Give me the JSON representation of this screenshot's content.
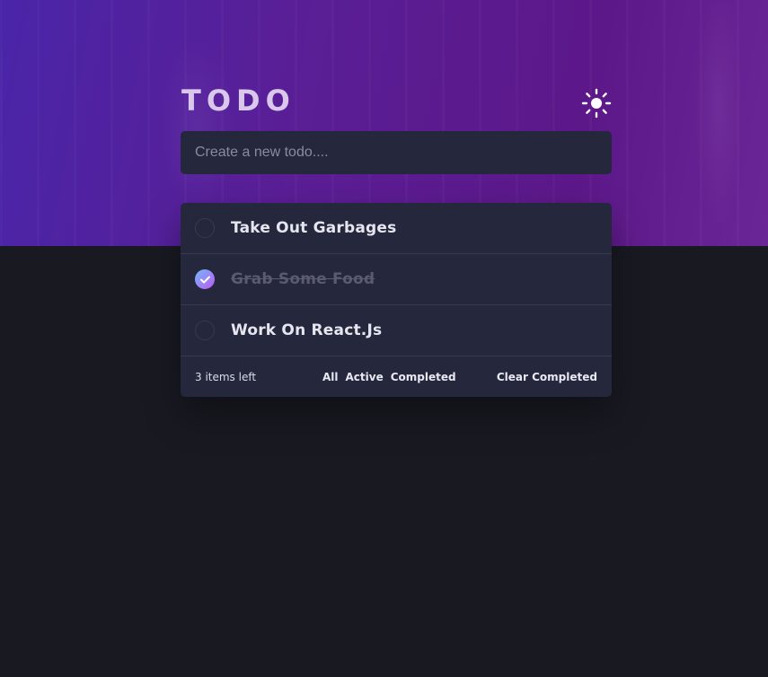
{
  "app": {
    "title": "TODO"
  },
  "new_todo": {
    "placeholder": "Create a new todo...."
  },
  "todos": [
    {
      "text": "Take Out Garbages",
      "completed": false
    },
    {
      "text": "Grab Some Food",
      "completed": true
    },
    {
      "text": "Work On React.Js",
      "completed": false
    }
  ],
  "footer": {
    "items_left": "3 items left",
    "filters": [
      "All",
      "Active",
      "Completed"
    ],
    "clear_label": "Clear Completed"
  },
  "icons": {
    "theme_toggle": "sun-icon",
    "completed_check": "checkmark-icon"
  },
  "colors": {
    "background": "#191922",
    "card": "#25273c",
    "hero_start": "#4a25a8",
    "hero_end": "#6a2596",
    "check_gradient_start": "#6fbbf8",
    "check_gradient_end": "#c058f3"
  }
}
